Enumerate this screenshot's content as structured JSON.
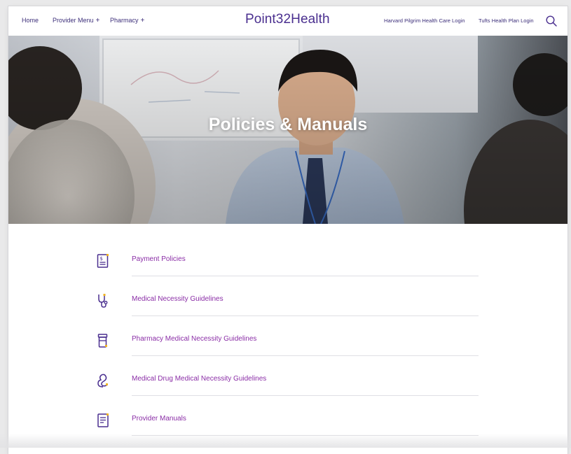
{
  "header": {
    "nav": [
      {
        "label": "Home",
        "has_plus": false
      },
      {
        "label": "Provider Menu",
        "has_plus": true
      },
      {
        "label": "Pharmacy",
        "has_plus": true
      }
    ],
    "plus_symbol": "+",
    "logo": "Point32Health",
    "logins": [
      {
        "label": "Harvard Pilgrim Health Care Login"
      },
      {
        "label": "Tufts Health Plan Login"
      }
    ],
    "search_icon": "search-icon"
  },
  "hero": {
    "title": "Policies & Manuals"
  },
  "list": {
    "items": [
      {
        "label": "Payment Policies",
        "icon": "document-dollar-icon"
      },
      {
        "label": "Medical Necessity Guidelines",
        "icon": "stethoscope-icon"
      },
      {
        "label": "Pharmacy Medical Necessity Guidelines",
        "icon": "pill-bottle-icon"
      },
      {
        "label": "Medical Drug Medical Necessity Guidelines",
        "icon": "medical-ribbon-icon"
      },
      {
        "label": "Provider Manuals",
        "icon": "manual-document-icon"
      }
    ]
  },
  "colors": {
    "brand_purple": "#4a2f8f",
    "link_magenta": "#8a2da6",
    "accent_gold": "#f0b323"
  }
}
